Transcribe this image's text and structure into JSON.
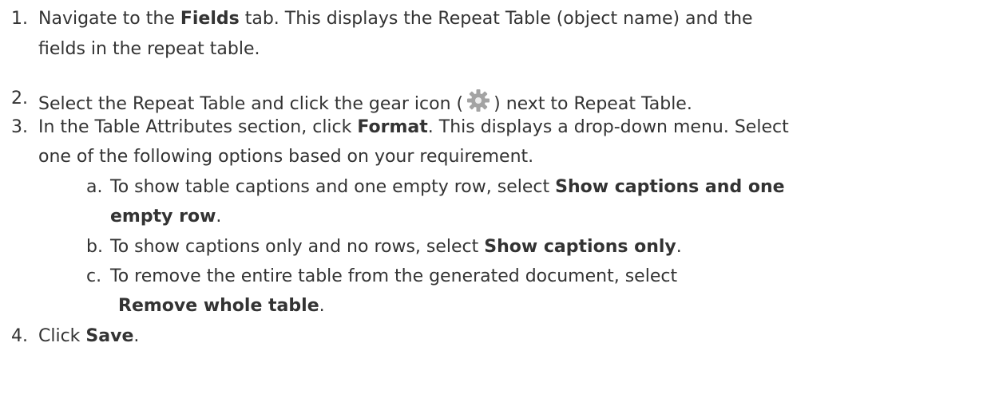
{
  "steps": [
    {
      "num": "1.",
      "l1_a": "Navigate to the ",
      "l1_b": "Fields",
      "l1_c": " tab. This displays the Repeat Table (object name) and the",
      "l2": "fields in the repeat table."
    },
    {
      "num": "2.",
      "a": "Select the Repeat Table and click the gear icon (",
      "b": ") next to Repeat Table."
    },
    {
      "num": "3.",
      "l1_a": "In the Table Attributes section, click ",
      "l1_b": "Format",
      "l1_c": ". This displays a drop-down menu. Select",
      "l2": "one of the following options based on your requirement."
    },
    {
      "num": "4.",
      "a": "Click ",
      "b": "Save",
      "c": "."
    }
  ],
  "substeps": [
    {
      "letter": "a.",
      "l1_a": "To show table captions and one empty row, select ",
      "l1_b": "Show captions and one",
      "l2_b": "empty row",
      "l2_c": "."
    },
    {
      "letter": "b.",
      "a": "To show captions only and no rows, select ",
      "b": "Show captions only",
      "c": "."
    },
    {
      "letter": "c.",
      "l1": "To remove the entire table from the generated document, select",
      "l2_b": "Remove whole table",
      "l2_c": "."
    }
  ],
  "icons": {
    "gear": "gear-icon",
    "gear_color": "#9a9a9a"
  }
}
